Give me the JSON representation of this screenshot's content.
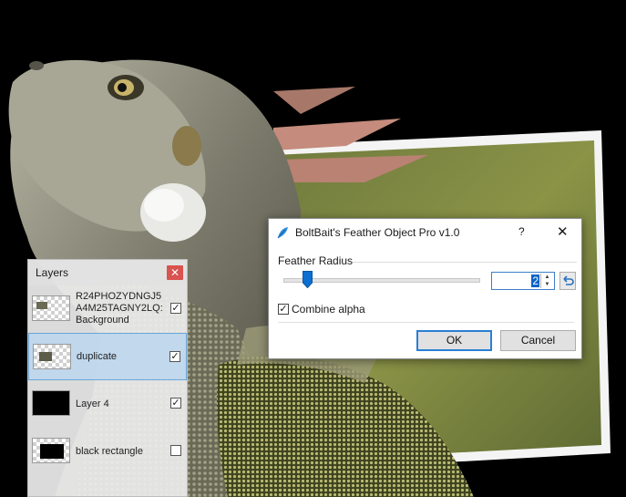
{
  "colors": {
    "selection_bg": "#bed7ee",
    "accent": "#0a64c8",
    "close_red": "#d9534f"
  },
  "layers_panel": {
    "title": "Layers",
    "close_icon": "close-icon",
    "layers": [
      {
        "name": "R24PHOZYDNGJ5A4M25TAGNY2LQ: Background",
        "visible": true,
        "selected": false,
        "thumb": "iguana"
      },
      {
        "name": "duplicate",
        "visible": true,
        "selected": true,
        "thumb": "iguana"
      },
      {
        "name": "Layer 4",
        "visible": true,
        "selected": false,
        "thumb": "black"
      },
      {
        "name": "black rectangle",
        "visible": false,
        "selected": false,
        "thumb": "rectangle"
      }
    ]
  },
  "dialog": {
    "title": "BoltBait's Feather Object Pro v1.0",
    "icon": "feather-icon",
    "help_label": "?",
    "close_label": "✕",
    "feather_radius": {
      "label": "Feather Radius",
      "value": "2",
      "min": 0,
      "max": 20,
      "reset_icon": "reset-arrow-icon"
    },
    "combine_alpha": {
      "label": "Combine alpha",
      "checked": true,
      "check_glyph": "✓"
    },
    "ok_label": "OK",
    "cancel_label": "Cancel"
  }
}
